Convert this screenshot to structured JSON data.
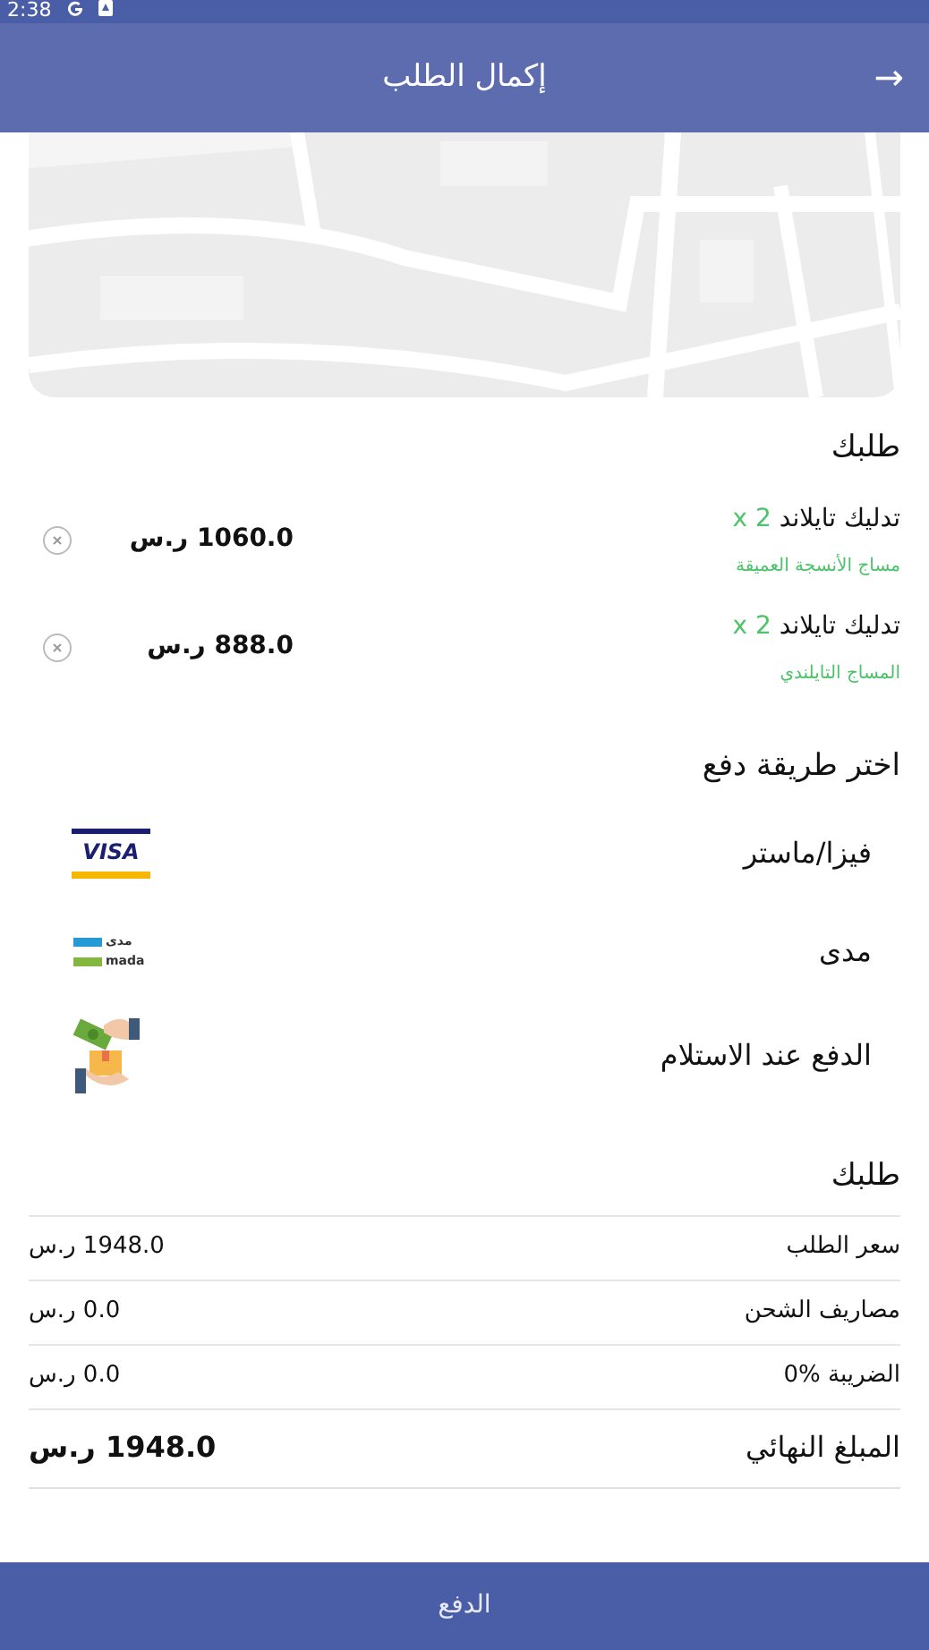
{
  "status_bar": {
    "time": "2:38"
  },
  "app_bar": {
    "title": "إكمال الطلب",
    "back_icon": "→"
  },
  "order": {
    "heading": "طلبك",
    "items": [
      {
        "name": "تدليك تايلاند",
        "quantity": "x 2",
        "description": "مساج الأنسجة العميقة",
        "price": "1060.0 ر.س"
      },
      {
        "name": "تدليك تايلاند",
        "quantity": "x 2",
        "description": "المساج التايلندي",
        "price": "888.0 ر.س"
      }
    ]
  },
  "payment": {
    "heading": "اختر طريقة دفع",
    "methods": [
      {
        "kind": "visa",
        "label": "فيزا/ماستر",
        "logo_text": [
          "VISA"
        ]
      },
      {
        "kind": "mada",
        "label": "مدى",
        "logo_text": [
          "مدى",
          "mada"
        ]
      },
      {
        "kind": "cash",
        "label": "الدفع عند الاستلام"
      }
    ]
  },
  "summary": {
    "heading": "طلبك",
    "rows": [
      {
        "label": "سعر الطلب",
        "value": "1948.0 ر.س",
        "total": false
      },
      {
        "label": "مصاريف الشحن",
        "value": "0.0 ر.س",
        "total": false
      },
      {
        "label": "الضريبة %0",
        "value": "0.0 ر.س",
        "total": false
      },
      {
        "label": "المبلغ النهائي",
        "value": "1948.0 ر.س",
        "total": true
      }
    ]
  },
  "pay_button": "الدفع"
}
